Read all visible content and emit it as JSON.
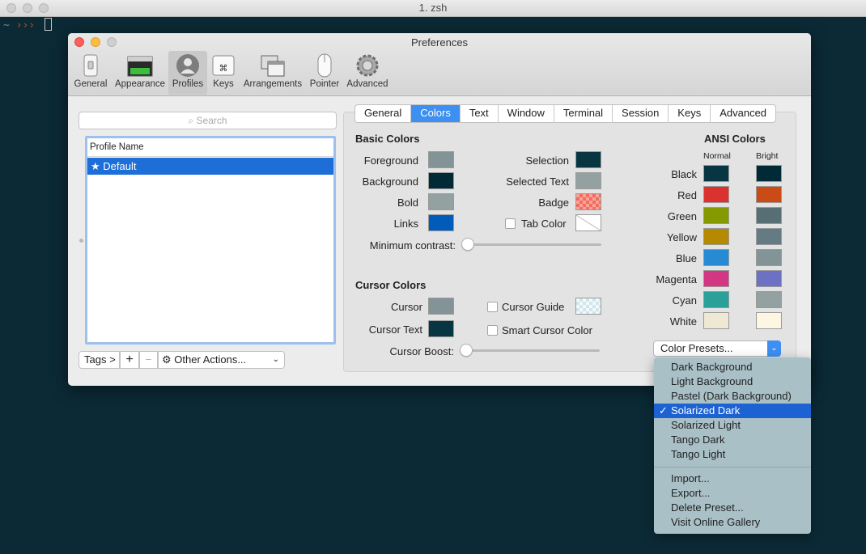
{
  "terminal": {
    "title": "1. zsh",
    "prompt_tilde": "~",
    "prompt_arrows": "›››"
  },
  "prefs": {
    "title": "Preferences",
    "toolbar": [
      "General",
      "Appearance",
      "Profiles",
      "Keys",
      "Arrangements",
      "Pointer",
      "Advanced"
    ],
    "search_placeholder": "Search",
    "profile_list": {
      "header": "Profile Name",
      "rows": [
        "★ Default"
      ]
    },
    "buttons": {
      "tags": "Tags >",
      "add": "+",
      "remove": "−",
      "other_actions": "Other Actions..."
    },
    "tabs": [
      "General",
      "Colors",
      "Text",
      "Window",
      "Terminal",
      "Session",
      "Keys",
      "Advanced"
    ],
    "selected_tab": "Colors",
    "basic": {
      "heading": "Basic Colors",
      "foreground": "Foreground",
      "background": "Background",
      "bold": "Bold",
      "links": "Links",
      "selection": "Selection",
      "selected_text": "Selected Text",
      "badge": "Badge",
      "tab_color": "Tab Color",
      "min_contrast": "Minimum contrast:",
      "colors": {
        "foreground": "#839496",
        "background": "#002b36",
        "bold": "#93a1a1",
        "links": "#005bbb",
        "selection": "#073642",
        "selected_text": "#93a1a1",
        "badge": "#f26d5c"
      }
    },
    "cursor": {
      "heading": "Cursor Colors",
      "cursor": "Cursor",
      "cursor_text": "Cursor Text",
      "cursor_guide": "Cursor Guide",
      "smart_cursor": "Smart Cursor Color",
      "cursor_boost": "Cursor Boost:",
      "colors": {
        "cursor": "#839496",
        "cursor_text": "#073642"
      }
    },
    "ansi": {
      "heading": "ANSI Colors",
      "normal": "Normal",
      "bright": "Bright",
      "rows": [
        {
          "name": "Black",
          "normal": "#073642",
          "bright": "#002b36"
        },
        {
          "name": "Red",
          "normal": "#dc322f",
          "bright": "#cb4b16"
        },
        {
          "name": "Green",
          "normal": "#859900",
          "bright": "#586e75"
        },
        {
          "name": "Yellow",
          "normal": "#b58900",
          "bright": "#657b83"
        },
        {
          "name": "Blue",
          "normal": "#268bd2",
          "bright": "#839496"
        },
        {
          "name": "Magenta",
          "normal": "#d33682",
          "bright": "#6c71c4"
        },
        {
          "name": "Cyan",
          "normal": "#2aa198",
          "bright": "#93a1a1"
        },
        {
          "name": "White",
          "normal": "#eee8d5",
          "bright": "#fdf6e3"
        }
      ]
    },
    "presets": {
      "label": "Color Presets...",
      "items": [
        "Dark Background",
        "Light Background",
        "Pastel (Dark Background)",
        "Solarized Dark",
        "Solarized Light",
        "Tango Dark",
        "Tango Light"
      ],
      "selected": "Solarized Dark",
      "actions": [
        "Import...",
        "Export...",
        "Delete Preset...",
        "Visit Online Gallery"
      ]
    }
  }
}
